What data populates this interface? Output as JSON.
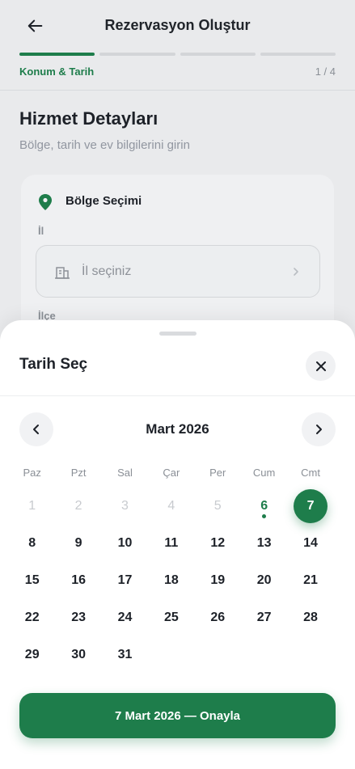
{
  "header": {
    "title": "Rezervasyon Oluştur",
    "step_label": "Konum & Tarih",
    "step_count": "1 / 4",
    "progress_segments": 4,
    "progress_active": 1
  },
  "main": {
    "section_title": "Hizmet Detayları",
    "section_subtitle": "Bölge, tarih ve ev bilgilerini girin",
    "region_card": {
      "title": "Bölge Seçimi",
      "city_label": "İl",
      "city_placeholder": "İl seçiniz",
      "district_label": "İlçe"
    }
  },
  "date_sheet": {
    "title": "Tarih Seç",
    "month_label": "Mart 2026",
    "weekdays": [
      "Paz",
      "Pzt",
      "Sal",
      "Çar",
      "Per",
      "Cum",
      "Cmt"
    ],
    "days": [
      {
        "label": "1",
        "state": "muted"
      },
      {
        "label": "2",
        "state": "muted"
      },
      {
        "label": "3",
        "state": "muted"
      },
      {
        "label": "4",
        "state": "muted"
      },
      {
        "label": "5",
        "state": "muted"
      },
      {
        "label": "6",
        "state": "today"
      },
      {
        "label": "7",
        "state": "selected"
      },
      {
        "label": "8",
        "state": "normal"
      },
      {
        "label": "9",
        "state": "normal"
      },
      {
        "label": "10",
        "state": "normal"
      },
      {
        "label": "11",
        "state": "normal"
      },
      {
        "label": "12",
        "state": "normal"
      },
      {
        "label": "13",
        "state": "normal"
      },
      {
        "label": "14",
        "state": "normal"
      },
      {
        "label": "15",
        "state": "normal"
      },
      {
        "label": "16",
        "state": "normal"
      },
      {
        "label": "17",
        "state": "normal"
      },
      {
        "label": "18",
        "state": "normal"
      },
      {
        "label": "19",
        "state": "normal"
      },
      {
        "label": "20",
        "state": "normal"
      },
      {
        "label": "21",
        "state": "normal"
      },
      {
        "label": "22",
        "state": "normal"
      },
      {
        "label": "23",
        "state": "normal"
      },
      {
        "label": "24",
        "state": "normal"
      },
      {
        "label": "25",
        "state": "normal"
      },
      {
        "label": "26",
        "state": "normal"
      },
      {
        "label": "27",
        "state": "normal"
      },
      {
        "label": "28",
        "state": "normal"
      },
      {
        "label": "29",
        "state": "normal"
      },
      {
        "label": "30",
        "state": "normal"
      },
      {
        "label": "31",
        "state": "normal"
      }
    ],
    "confirm_label": "7 Mart 2026 — Onayla"
  },
  "icons": {
    "back": "arrow-left-icon",
    "pin": "map-pin-icon",
    "city": "building-icon",
    "chevron": "chevron-right-icon",
    "close": "close-icon",
    "prev": "chevron-left-icon",
    "next": "chevron-right-icon"
  },
  "colors": {
    "accent": "#1e7d4b",
    "background": "#e9eaec",
    "sheet": "#ffffff",
    "muted_text": "#8a8f96"
  }
}
